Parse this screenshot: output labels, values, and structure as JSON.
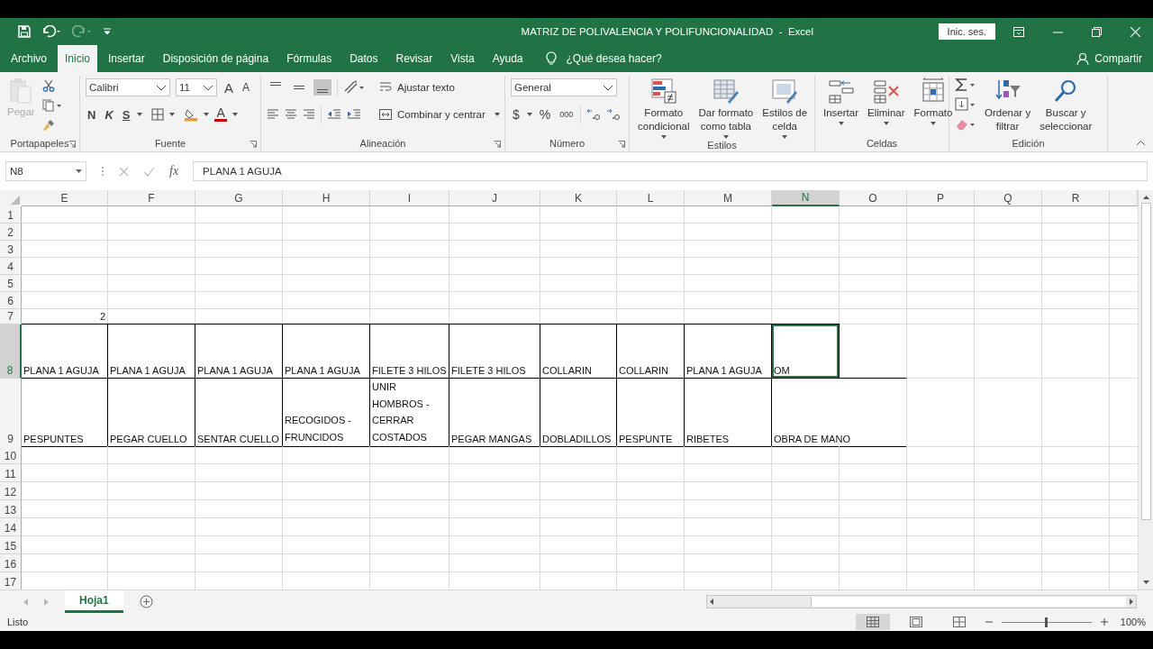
{
  "window": {
    "title": "MATRIZ DE POLIVALENCIA Y POLIFUNCIONALIDAD  -  Excel",
    "sign_in": "Inic. ses."
  },
  "tabs": [
    {
      "label": "Archivo",
      "selected": false
    },
    {
      "label": "Inicio",
      "selected": true
    },
    {
      "label": "Insertar",
      "selected": false
    },
    {
      "label": "Disposición de página",
      "selected": false
    },
    {
      "label": "Fórmulas",
      "selected": false
    },
    {
      "label": "Datos",
      "selected": false
    },
    {
      "label": "Revisar",
      "selected": false
    },
    {
      "label": "Vista",
      "selected": false
    },
    {
      "label": "Ayuda",
      "selected": false
    }
  ],
  "tell_me": "¿Qué desea hacer?",
  "share": "Compartir",
  "ribbon": {
    "clipboard": {
      "label": "Portapapeles",
      "paste": "Pegar",
      "paste_disabled": true
    },
    "font": {
      "label": "Fuente",
      "name": "Calibri",
      "size": "11",
      "grow": "A",
      "shrink": "A",
      "bold": "N",
      "italic": "K",
      "underline": "S",
      "color_letter": "A"
    },
    "alignment": {
      "label": "Alineación",
      "vertical": [
        {
          "selected": false
        },
        {
          "selected": false
        },
        {
          "selected": true
        }
      ],
      "wrap": "Ajustar texto",
      "merge": "Combinar y centrar"
    },
    "number": {
      "label": "Número",
      "format": "General",
      "currency": "$",
      "percent": "%",
      "thousands": "000"
    },
    "styles": {
      "label": "Estilos",
      "buttons": [
        {
          "kind": "conditional",
          "lines": [
            "Formato",
            "condicional"
          ]
        },
        {
          "kind": "table",
          "lines": [
            "Dar formato",
            "como tabla"
          ]
        },
        {
          "kind": "cellstyle",
          "lines": [
            "Estilos de",
            "celda"
          ]
        }
      ]
    },
    "cells": {
      "label": "Celdas",
      "buttons": [
        {
          "kind": "insert",
          "lines": [
            "Insertar"
          ]
        },
        {
          "kind": "delete",
          "lines": [
            "Eliminar"
          ]
        },
        {
          "kind": "format",
          "lines": [
            "Formato"
          ]
        }
      ]
    },
    "editing": {
      "label": "Edición",
      "buttons": [
        {
          "kind": "sort",
          "lines": [
            "Ordenar y",
            "filtrar"
          ]
        },
        {
          "kind": "find",
          "lines": [
            "Buscar y",
            "seleccionar"
          ]
        }
      ]
    }
  },
  "formula_bar": {
    "name_box": "N8",
    "fx": "fx",
    "value": "PLANA 1 AGUJA"
  },
  "sheet": {
    "columns": [
      {
        "label": "E",
        "selected": false
      },
      {
        "label": "F",
        "selected": false
      },
      {
        "label": "G",
        "selected": false
      },
      {
        "label": "H",
        "selected": false
      },
      {
        "label": "I",
        "selected": false
      },
      {
        "label": "J",
        "selected": false
      },
      {
        "label": "K",
        "selected": false
      },
      {
        "label": "L",
        "selected": false
      },
      {
        "label": "M",
        "selected": false
      },
      {
        "label": "N",
        "selected": true
      },
      {
        "label": "O",
        "selected": false
      },
      {
        "label": "P",
        "selected": false
      },
      {
        "label": "Q",
        "selected": false
      },
      {
        "label": "R",
        "selected": false
      }
    ],
    "rows": [
      {
        "header": "1",
        "selected": false,
        "cells": []
      },
      {
        "header": "2",
        "selected": false,
        "cells": []
      },
      {
        "header": "3",
        "selected": false,
        "cells": []
      },
      {
        "header": "4",
        "selected": false,
        "cells": []
      },
      {
        "header": "5",
        "selected": false,
        "cells": []
      },
      {
        "header": "6",
        "selected": false,
        "cells": []
      },
      {
        "header": "7",
        "selected": false,
        "cells": [
          {
            "text": "2",
            "kind": "number",
            "selected": false
          }
        ]
      },
      {
        "header": "8",
        "selected": true,
        "bordered": true,
        "cells": [
          {
            "text": "PLANA 1 AGUJA",
            "selected": false
          },
          {
            "text": "PLANA 1 AGUJA",
            "selected": false
          },
          {
            "text": "PLANA 1 AGUJA",
            "selected": false
          },
          {
            "text": "PLANA 1 AGUJA",
            "selected": false
          },
          {
            "text": "FILETE 3 HILOS",
            "selected": false
          },
          {
            "text": "FILETE 3 HILOS",
            "selected": false
          },
          {
            "text": "COLLARIN",
            "selected": false
          },
          {
            "text": "COLLARIN",
            "selected": false
          },
          {
            "text": "PLANA 1 AGUJA",
            "selected": false
          },
          {
            "text": "OM",
            "selected": true
          }
        ]
      },
      {
        "header": "9",
        "selected": false,
        "bordered": true,
        "cells": [
          {
            "text": "PESPUNTES",
            "selected": false
          },
          {
            "text": "PEGAR CUELLO",
            "selected": false
          },
          {
            "text": "SENTAR CUELLO",
            "selected": false
          },
          {
            "text": "RECOGIDOS - FRUNCIDOS",
            "wrap": true,
            "selected": false
          },
          {
            "text": "UNIR HOMBROS - CERRAR COSTADOS",
            "wrap": true,
            "selected": false
          },
          {
            "text": "PEGAR MANGAS",
            "selected": false
          },
          {
            "text": "DOBLADILLOS",
            "selected": false
          },
          {
            "text": "PESPUNTE",
            "selected": false
          },
          {
            "text": "RIBETES",
            "selected": false
          },
          {
            "text": "OBRA DE MANO",
            "overflows": true,
            "selected": false
          }
        ]
      },
      {
        "header": "10",
        "selected": false,
        "cells": []
      },
      {
        "header": "11",
        "selected": false,
        "cells": []
      },
      {
        "header": "12",
        "selected": false,
        "cells": []
      },
      {
        "header": "13",
        "selected": false,
        "cells": []
      },
      {
        "header": "14",
        "selected": false,
        "cells": []
      },
      {
        "header": "15",
        "selected": false,
        "cells": []
      },
      {
        "header": "16",
        "selected": false,
        "cells": []
      },
      {
        "header": "17",
        "selected": false,
        "cells": []
      }
    ]
  },
  "sheet_tabs": [
    {
      "label": "Hoja1",
      "selected": true
    }
  ],
  "status_bar": {
    "text": "Listo",
    "views": [
      {
        "selected": true
      },
      {
        "selected": false
      },
      {
        "selected": false
      }
    ],
    "zoom": {
      "level": 0.5,
      "reading": "100%"
    }
  }
}
